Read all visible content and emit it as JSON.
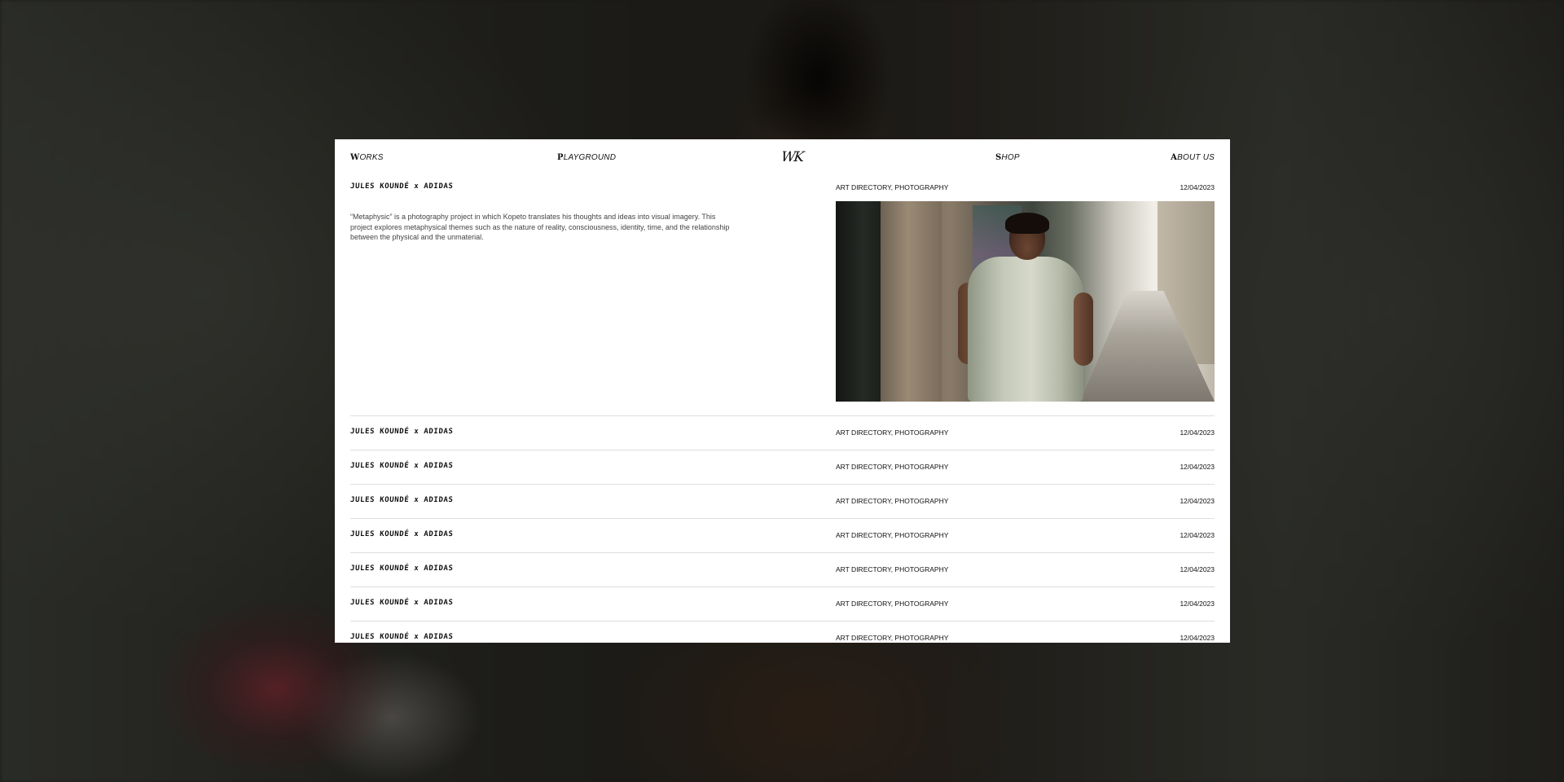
{
  "nav": {
    "works": {
      "cap": "W",
      "rest": "ORKS"
    },
    "playground": {
      "cap": "P",
      "rest": "LAYGROUND"
    },
    "logo": "WK",
    "shop": {
      "cap": "S",
      "rest": "HOP"
    },
    "about": {
      "cap": "A",
      "rest": "BOUT US"
    }
  },
  "featured": {
    "title": "JULES KOUNDÉ x ADIDAS",
    "category": "ART DIRECTORY, PHOTOGRAPHY",
    "date": "12/04/2023",
    "description": "“Metaphysic” is a photography project in which Kopeto translates his thoughts and ideas into visual imagery. This project explores metaphysical themes such as the nature of reality, consciousness, identity, time, and the relationship between the physical and the unmaterial."
  },
  "projects": [
    {
      "title": "JULES KOUNDÉ x ADIDAS",
      "category": "ART DIRECTORY, PHOTOGRAPHY",
      "date": "12/04/2023"
    },
    {
      "title": "JULES KOUNDÉ x ADIDAS",
      "category": "ART DIRECTORY, PHOTOGRAPHY",
      "date": "12/04/2023"
    },
    {
      "title": "JULES KOUNDÉ x ADIDAS",
      "category": "ART DIRECTORY, PHOTOGRAPHY",
      "date": "12/04/2023"
    },
    {
      "title": "JULES KOUNDÉ x ADIDAS",
      "category": "ART DIRECTORY, PHOTOGRAPHY",
      "date": "12/04/2023"
    },
    {
      "title": "JULES KOUNDÉ x ADIDAS",
      "category": "ART DIRECTORY, PHOTOGRAPHY",
      "date": "12/04/2023"
    },
    {
      "title": "JULES KOUNDÉ x ADIDAS",
      "category": "ART DIRECTORY, PHOTOGRAPHY",
      "date": "12/04/2023"
    },
    {
      "title": "JULES KOUNDÉ x ADIDAS",
      "category": "ART DIRECTORY, PHOTOGRAPHY",
      "date": "12/04/2023"
    }
  ]
}
